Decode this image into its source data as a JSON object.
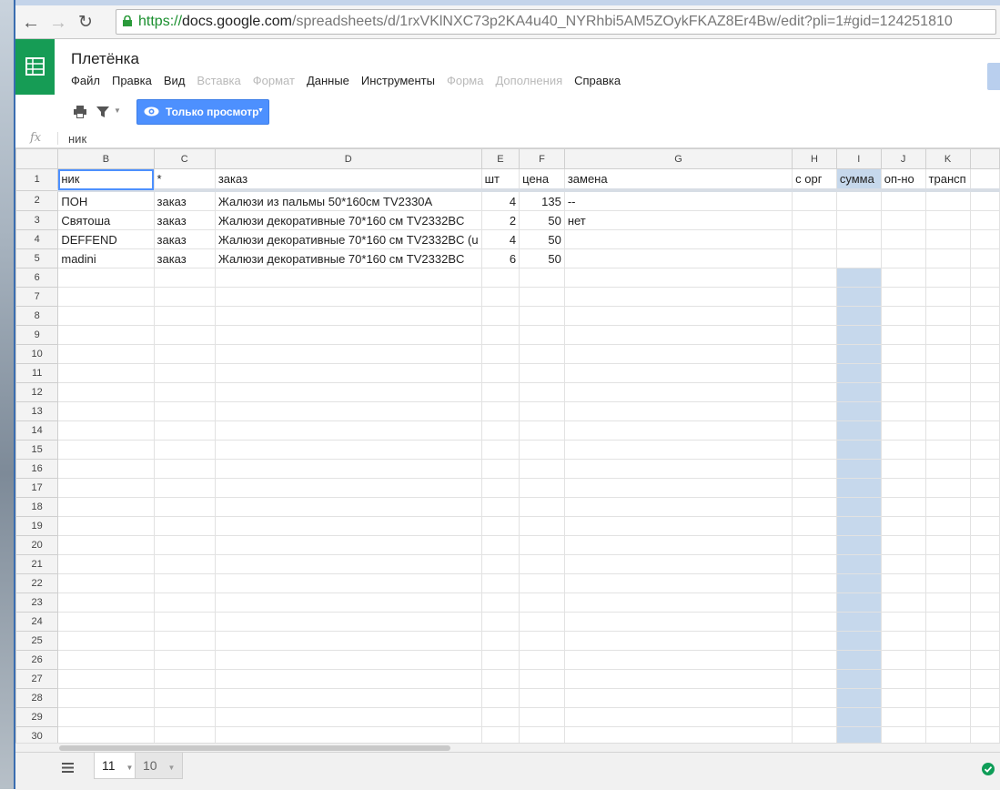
{
  "browser": {
    "url_scheme": "https://",
    "url_host": "docs.google.com",
    "url_path": "/spreadsheets/d/1rxVKlNXC73p2KA4u40_NYRhbi5AM5ZOykFKAZ8Er4Bw/edit?pli=1#gid=124251810"
  },
  "doc": {
    "title": "Плетёнка",
    "menu": [
      {
        "label": "Файл",
        "disabled": false
      },
      {
        "label": "Правка",
        "disabled": false
      },
      {
        "label": "Вид",
        "disabled": false
      },
      {
        "label": "Вставка",
        "disabled": true
      },
      {
        "label": "Формат",
        "disabled": true
      },
      {
        "label": "Данные",
        "disabled": false
      },
      {
        "label": "Инструменты",
        "disabled": false
      },
      {
        "label": "Форма",
        "disabled": true
      },
      {
        "label": "Дополнения",
        "disabled": true
      },
      {
        "label": "Справка",
        "disabled": false
      }
    ]
  },
  "toolbar": {
    "view_only_label": "Только просмотр"
  },
  "formula_bar": {
    "fx_label": "fx",
    "value": "ник"
  },
  "grid": {
    "columns": [
      "B",
      "C",
      "D",
      "E",
      "F",
      "G",
      "H",
      "I",
      "J",
      "K"
    ],
    "selected_column": "I",
    "rows": [
      {
        "n": "1",
        "cells": [
          "ник",
          "*",
          "заказ",
          "шт",
          "цена",
          "замена",
          "с орг",
          "сумма",
          "оп-но",
          "трансп"
        ]
      },
      {
        "n": "2",
        "cells": [
          "ПОН",
          "заказ",
          " Жалюзи из пальмы 50*160см TV2330A",
          "4",
          "135",
          "--",
          "",
          "",
          "",
          ""
        ]
      },
      {
        "n": "3",
        "cells": [
          "Святоша",
          "заказ",
          "Жалюзи декоративные 70*160 см TV2332BC",
          "2",
          "50",
          "нет",
          "",
          "",
          "",
          ""
        ]
      },
      {
        "n": "4",
        "cells": [
          "DEFFEND",
          "заказ",
          "Жалюзи декоративные 70*160 см TV2332BC (u",
          "4",
          "50",
          "",
          "",
          "",
          "",
          ""
        ]
      },
      {
        "n": "5",
        "cells": [
          "madini",
          "заказ",
          "Жалюзи декоративные 70*160 см TV2332BC",
          "6",
          "50",
          "",
          "",
          "",
          "",
          ""
        ]
      }
    ],
    "empty_rows": [
      "6",
      "7",
      "8",
      "9",
      "10",
      "11",
      "12",
      "13",
      "14",
      "15",
      "16",
      "17",
      "18",
      "19",
      "20",
      "21",
      "22",
      "23",
      "24",
      "25",
      "26",
      "27",
      "28",
      "29",
      "30"
    ]
  },
  "sheets": {
    "all_sheets_icon": "list-icon",
    "tabs": [
      {
        "label": "11",
        "active": true
      },
      {
        "label": "10",
        "active": false
      }
    ]
  },
  "status": {
    "saved_icon": "check-circle-icon"
  }
}
